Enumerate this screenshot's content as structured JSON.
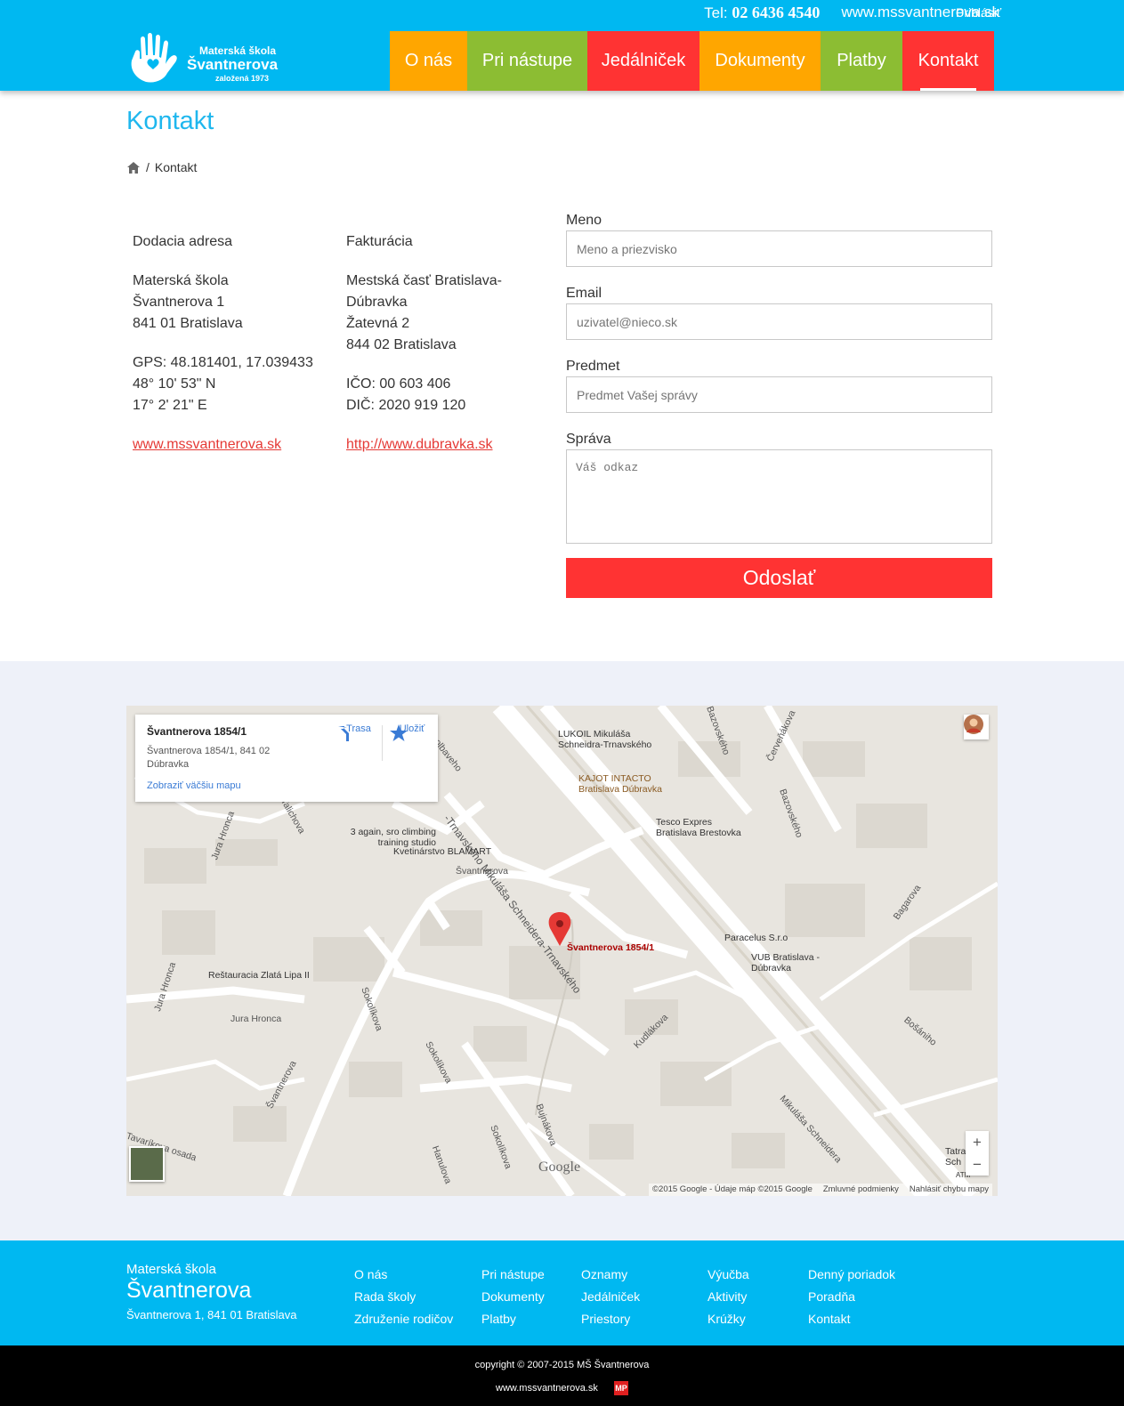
{
  "header": {
    "tel_label": "Tel:",
    "tel_number": "02 6436 4540",
    "website": "www.mssvantnerova.sk",
    "login": "Prihlásiť",
    "logo": {
      "line1": "Materská škola",
      "line2": "Švantnerova",
      "line3": "založená 1973"
    },
    "nav": [
      {
        "label": "O nás",
        "color": "#ffa600"
      },
      {
        "label": "Pri nástupe",
        "color": "#8cbd33"
      },
      {
        "label": "Jedálniček",
        "color": "#ff3333"
      },
      {
        "label": "Dokumenty",
        "color": "#ffa600"
      },
      {
        "label": "Platby",
        "color": "#8cbd33"
      },
      {
        "label": "Kontakt",
        "color": "#ff3333",
        "active": true
      }
    ]
  },
  "page": {
    "title": "Kontakt",
    "breadcrumb": {
      "home_icon": "home-icon",
      "separator": "/",
      "current": "Kontakt"
    }
  },
  "delivery": {
    "heading": "Dodacia adresa",
    "name": "Materská škola",
    "street": "Švantnerova 1",
    "city": "841 01 Bratislava",
    "gps": "GPS: 48.181401, 17.039433",
    "lat": "48° 10' 53\" N",
    "lon": "17° 2' 21\" E",
    "link": "www.mssvantnerova.sk"
  },
  "billing": {
    "heading": "Fakturácia",
    "name1": "Mestská časť Bratislava-",
    "name2": "Dúbravka",
    "street": "Žatevná 2",
    "city": "844 02 Bratislava",
    "ico": "IČO: 00 603 406",
    "dic": "DIČ: 2020 919 120",
    "link": "http://www.dubravka.sk"
  },
  "form": {
    "name_label": "Meno",
    "name_placeholder": "Meno a priezvisko",
    "email_label": "Email",
    "email_placeholder": "uzivatel@nieco.sk",
    "subject_label": "Predmet",
    "subject_placeholder": "Predmet Vašej správy",
    "message_label": "Správa",
    "message_placeholder": "Váš odkaz",
    "submit": "Odoslať"
  },
  "map": {
    "info": {
      "title": "Švantnerova 1854/1",
      "address": "Švantnerova 1854/1, 841 02 Dúbravka",
      "larger_map": "Zobraziť väčšiu mapu",
      "directions": "Trasa",
      "save": "Uložiť"
    },
    "marker_label": "Švantnerova 1854/1",
    "labels": {
      "lukoil": "LUKOIL Mikuláša Schneidra-Trnavského",
      "kajot": "KAJOT INTACTO Bratislava Dúbravka",
      "tesco": "Tesco Expres Bratislava Brestovka",
      "climbing": "3 again, sro climbing training studio",
      "blamart": "Kvetinárstvo BLAMART",
      "paracelus": "Paracelus S.r.o",
      "vub": "VUB Bratislava - Dúbravka",
      "restauracia": "Reštauracia Zlatá Lipa II",
      "svantnerova_street": "Švantnerova",
      "svantnerova_street2": "Švantnerova",
      "jura_hronca": "Jura Hronca",
      "jura_hronca2": "Jura Hronca",
      "jura_hronca3": "Jura Hronca",
      "talichova": "Talichova",
      "sokolikova": "Sokolíkova",
      "sokolikova2": "Sokolíkova",
      "sokolikova3": "Sokolíkova",
      "kudlakova": "Kudlákova",
      "bujnakova": "Bujnákova",
      "hanulova": "Hanulova",
      "tavarikova": "Tavaríkova osada",
      "bagarova": "Bagarova",
      "bosaniho": "Bošániho",
      "bazovskeho": "Bazovského",
      "bazovskeho2": "Bazovského",
      "cervenakova": "Červeňákova",
      "mikulasa": "Mikuláša Schneidera",
      "mikulasa_main": "-Trnavského Mikuláša Schneidera-Trnavského",
      "olbaveho": "olbaveho",
      "tatra": "Tatra Sch",
      "atm": "ATM"
    },
    "copyright": "©2015 Google - Údaje máp ©2015 Google",
    "terms": "Zmluvné podmienky",
    "report": "Nahlásiť chybu mapy",
    "google": "Google"
  },
  "footer": {
    "brand1": "Materská škola",
    "brand2": "Švantnerova",
    "brand3": "Švantnerova 1, 841 01 Bratislava",
    "col1": [
      "O nás",
      "Rada školy",
      "Združenie rodičov"
    ],
    "col2": [
      "Pri nástupe",
      "Dokumenty",
      "Platby"
    ],
    "col3": [
      "Oznamy",
      "Jedálniček",
      "Priestory"
    ],
    "col4": [
      "Výučba",
      "Aktivity",
      "Krúžky"
    ],
    "col5": [
      "Denný poriadok",
      "Poradňa",
      "Kontakt"
    ],
    "copyright": "copyright © 2007-2015 MŠ Švantnerova",
    "site": "www.mssvantnerova.sk",
    "badge": "MP"
  }
}
